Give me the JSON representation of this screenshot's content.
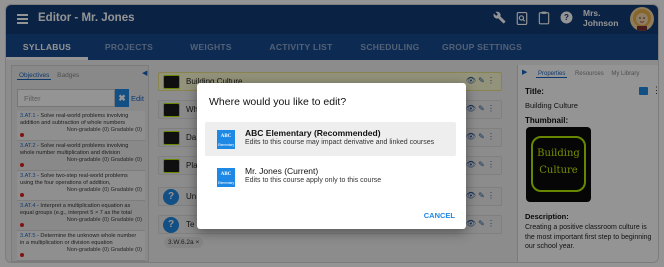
{
  "app": {
    "title": "Editor - Mr. Jones",
    "user_name_line1": "Mrs.",
    "user_name_line2": "Johnson"
  },
  "nav_tabs": [
    "SYLLABUS",
    "PROJECTS",
    "WEIGHTS",
    "ACTIVITY LIST",
    "SCHEDULING",
    "GROUP SETTINGS"
  ],
  "left_panel": {
    "tabs": [
      "Objectives",
      "Badges"
    ],
    "filter_placeholder": "Filter",
    "edit_label": "Edit",
    "standards": [
      {
        "code": "3.AT.1",
        "text": " - Solve real-world problems involving addition and subtraction of whole numbers",
        "meta": "Non-gradable (0)   Gradable (0)"
      },
      {
        "code": "3.AT.2",
        "text": " - Solve real-world problems involving whole number multiplication and division",
        "meta": "Non-gradable (0)   Gradable (0)"
      },
      {
        "code": "3.AT.3",
        "text": " - Solve two-step real-world problems using the four operations of addition,",
        "meta": "Non-gradable (0)   Gradable (0)"
      },
      {
        "code": "3.AT.4",
        "text": " - Interpret a multiplication equation as equal groups (e.g., interpret 5 × 7 as the total",
        "meta": "Non-gradable (0)   Gradable (0)"
      },
      {
        "code": "3.AT.5",
        "text": " - Determine the unknown whole number in a multiplication or division equation",
        "meta": "Non-gradable (0)   Gradable (0)"
      }
    ]
  },
  "center": {
    "rows": [
      {
        "label": "Building Culture",
        "kind": "thumb"
      },
      {
        "label": "Wh",
        "kind": "thumb"
      },
      {
        "label": "Da",
        "kind": "thumb"
      },
      {
        "label": "Pla",
        "kind": "thumb"
      },
      {
        "label": "Un",
        "kind": "question"
      },
      {
        "label": "Te",
        "kind": "question"
      }
    ],
    "tag": "3.W.6.2a",
    "tag_close": "×"
  },
  "right_panel": {
    "tabs": [
      "Properties",
      "Resources",
      "My Library"
    ],
    "title_heading": "Title:",
    "title_value": "Building Culture",
    "thumbnail_heading": "Thumbnail:",
    "thumbnail_text_1": "Building",
    "thumbnail_text_2": "Culture",
    "description_heading": "Description:",
    "description_text": "Creating a positive classroom culture is the most important first step to beginning our school year."
  },
  "dialog": {
    "title": "Where would you like to edit?",
    "options": [
      {
        "icon_text": "ABC Elementary",
        "title": "ABC Elementary (Recommended)",
        "subtitle": "Edits to this course may impact derivative and linked courses"
      },
      {
        "icon_text": "ABC Elementary",
        "title": "Mr. Jones (Current)",
        "subtitle": "Edits to this course apply only to this course"
      }
    ],
    "cancel_label": "CANCEL"
  },
  "colors": {
    "header_bg": "#123c76",
    "tabs_bg": "#184a8e",
    "accent_blue": "#1e88e5",
    "thumb_accent": "#b4e800",
    "cancel_text": "#1e88e5"
  }
}
